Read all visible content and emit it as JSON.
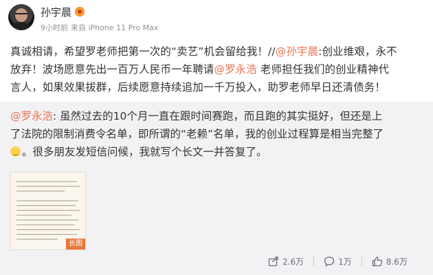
{
  "post": {
    "author": {
      "name": "孙宇晨"
    },
    "meta": {
      "time": "9小时前",
      "source": "来自 iPhone 11 Pro Max"
    },
    "content_lines": {
      "l1_a": "真诚相请，希望罗老师把第一次的“卖艺”机会留给我！//",
      "l1_mention": "@孙宇晨",
      "l1_b": ":创业维艰，永不",
      "l2": "放弃！波场愿意先出一百万人民币一年聘请",
      "l2_mention": "@罗永浩",
      "l2_b": " 老师担任我们的创业精神代",
      "l3": "言人，如果效果拔群，后续愿意持续追加一千万投入，助罗老师早日还清债务！"
    },
    "repost": {
      "mention": "@罗永浩",
      "line1": ": 虽然过去的10个月一直在跟时间赛跑，而且跑的其实挺好，但还是上",
      "line2": "了法院的限制消费令名单，即所谓的“老赖”名单，我的创业过程算是相当完整了",
      "line3": "。很多朋友发短信问候，我就写个长文一并答复了。",
      "thumb_tag": "长图"
    },
    "actions": {
      "share_count": "2.6万",
      "comment_count": "1万",
      "like_count": "8.6万"
    }
  },
  "colors": {
    "link": "#eb7350",
    "text": "#333333",
    "muted": "#939393",
    "repost_bg": "#f2f2f5"
  },
  "icons": [
    "avatar",
    "vip-badge-icon",
    "share-icon",
    "comment-icon",
    "like-icon",
    "smile-emoji-icon"
  ]
}
